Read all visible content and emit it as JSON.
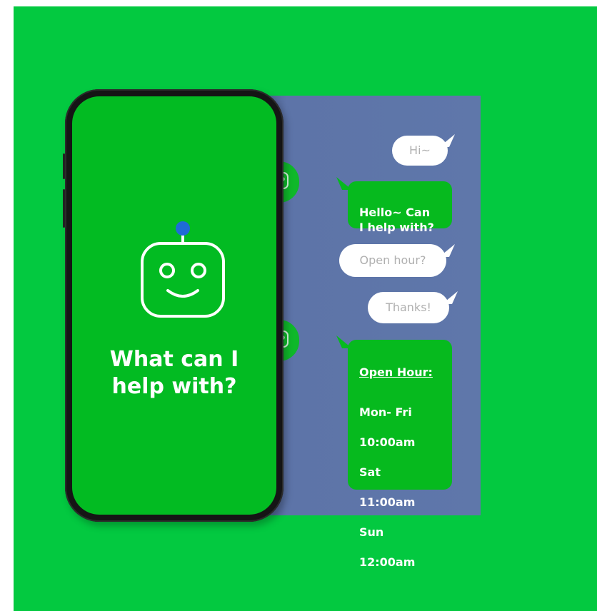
{
  "phone": {
    "title": "What can I\nhelp with?"
  },
  "chat": {
    "messages": [
      {
        "sender": "user",
        "text": "Hi~"
      },
      {
        "sender": "bot",
        "text": "Hello~ Can\nI help with?"
      },
      {
        "sender": "user",
        "text": "Open hour?"
      },
      {
        "sender": "user",
        "text": "Thanks!"
      },
      {
        "sender": "bot",
        "heading": "Open Hour:",
        "lines": [
          "Mon- Fri",
          "10:00am",
          "Sat",
          "11:00am",
          "Sun",
          "12:00am"
        ]
      }
    ]
  },
  "colors": {
    "background": "#03c940",
    "screen": "#02bb22",
    "panel": "#5f77aa",
    "bot_bubble": "#06ba1e",
    "user_bubble": "#ffffff",
    "antenna": "#1f6bd6"
  },
  "icons": [
    "robot-face-icon",
    "robot-avatar-icon"
  ]
}
